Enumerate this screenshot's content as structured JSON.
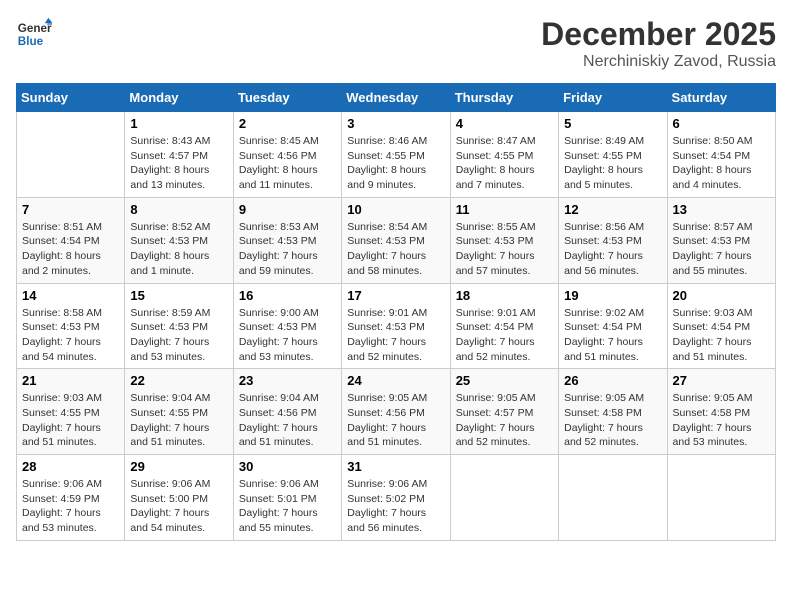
{
  "logo": {
    "line1": "General",
    "line2": "Blue"
  },
  "title": "December 2025",
  "subtitle": "Nerchiniskiy Zavod, Russia",
  "days_of_week": [
    "Sunday",
    "Monday",
    "Tuesday",
    "Wednesday",
    "Thursday",
    "Friday",
    "Saturday"
  ],
  "weeks": [
    [
      {
        "day": "",
        "info": ""
      },
      {
        "day": "1",
        "info": "Sunrise: 8:43 AM\nSunset: 4:57 PM\nDaylight: 8 hours\nand 13 minutes."
      },
      {
        "day": "2",
        "info": "Sunrise: 8:45 AM\nSunset: 4:56 PM\nDaylight: 8 hours\nand 11 minutes."
      },
      {
        "day": "3",
        "info": "Sunrise: 8:46 AM\nSunset: 4:55 PM\nDaylight: 8 hours\nand 9 minutes."
      },
      {
        "day": "4",
        "info": "Sunrise: 8:47 AM\nSunset: 4:55 PM\nDaylight: 8 hours\nand 7 minutes."
      },
      {
        "day": "5",
        "info": "Sunrise: 8:49 AM\nSunset: 4:55 PM\nDaylight: 8 hours\nand 5 minutes."
      },
      {
        "day": "6",
        "info": "Sunrise: 8:50 AM\nSunset: 4:54 PM\nDaylight: 8 hours\nand 4 minutes."
      }
    ],
    [
      {
        "day": "7",
        "info": "Sunrise: 8:51 AM\nSunset: 4:54 PM\nDaylight: 8 hours\nand 2 minutes."
      },
      {
        "day": "8",
        "info": "Sunrise: 8:52 AM\nSunset: 4:53 PM\nDaylight: 8 hours\nand 1 minute."
      },
      {
        "day": "9",
        "info": "Sunrise: 8:53 AM\nSunset: 4:53 PM\nDaylight: 7 hours\nand 59 minutes."
      },
      {
        "day": "10",
        "info": "Sunrise: 8:54 AM\nSunset: 4:53 PM\nDaylight: 7 hours\nand 58 minutes."
      },
      {
        "day": "11",
        "info": "Sunrise: 8:55 AM\nSunset: 4:53 PM\nDaylight: 7 hours\nand 57 minutes."
      },
      {
        "day": "12",
        "info": "Sunrise: 8:56 AM\nSunset: 4:53 PM\nDaylight: 7 hours\nand 56 minutes."
      },
      {
        "day": "13",
        "info": "Sunrise: 8:57 AM\nSunset: 4:53 PM\nDaylight: 7 hours\nand 55 minutes."
      }
    ],
    [
      {
        "day": "14",
        "info": "Sunrise: 8:58 AM\nSunset: 4:53 PM\nDaylight: 7 hours\nand 54 minutes."
      },
      {
        "day": "15",
        "info": "Sunrise: 8:59 AM\nSunset: 4:53 PM\nDaylight: 7 hours\nand 53 minutes."
      },
      {
        "day": "16",
        "info": "Sunrise: 9:00 AM\nSunset: 4:53 PM\nDaylight: 7 hours\nand 53 minutes."
      },
      {
        "day": "17",
        "info": "Sunrise: 9:01 AM\nSunset: 4:53 PM\nDaylight: 7 hours\nand 52 minutes."
      },
      {
        "day": "18",
        "info": "Sunrise: 9:01 AM\nSunset: 4:54 PM\nDaylight: 7 hours\nand 52 minutes."
      },
      {
        "day": "19",
        "info": "Sunrise: 9:02 AM\nSunset: 4:54 PM\nDaylight: 7 hours\nand 51 minutes."
      },
      {
        "day": "20",
        "info": "Sunrise: 9:03 AM\nSunset: 4:54 PM\nDaylight: 7 hours\nand 51 minutes."
      }
    ],
    [
      {
        "day": "21",
        "info": "Sunrise: 9:03 AM\nSunset: 4:55 PM\nDaylight: 7 hours\nand 51 minutes."
      },
      {
        "day": "22",
        "info": "Sunrise: 9:04 AM\nSunset: 4:55 PM\nDaylight: 7 hours\nand 51 minutes."
      },
      {
        "day": "23",
        "info": "Sunrise: 9:04 AM\nSunset: 4:56 PM\nDaylight: 7 hours\nand 51 minutes."
      },
      {
        "day": "24",
        "info": "Sunrise: 9:05 AM\nSunset: 4:56 PM\nDaylight: 7 hours\nand 51 minutes."
      },
      {
        "day": "25",
        "info": "Sunrise: 9:05 AM\nSunset: 4:57 PM\nDaylight: 7 hours\nand 52 minutes."
      },
      {
        "day": "26",
        "info": "Sunrise: 9:05 AM\nSunset: 4:58 PM\nDaylight: 7 hours\nand 52 minutes."
      },
      {
        "day": "27",
        "info": "Sunrise: 9:05 AM\nSunset: 4:58 PM\nDaylight: 7 hours\nand 53 minutes."
      }
    ],
    [
      {
        "day": "28",
        "info": "Sunrise: 9:06 AM\nSunset: 4:59 PM\nDaylight: 7 hours\nand 53 minutes."
      },
      {
        "day": "29",
        "info": "Sunrise: 9:06 AM\nSunset: 5:00 PM\nDaylight: 7 hours\nand 54 minutes."
      },
      {
        "day": "30",
        "info": "Sunrise: 9:06 AM\nSunset: 5:01 PM\nDaylight: 7 hours\nand 55 minutes."
      },
      {
        "day": "31",
        "info": "Sunrise: 9:06 AM\nSunset: 5:02 PM\nDaylight: 7 hours\nand 56 minutes."
      },
      {
        "day": "",
        "info": ""
      },
      {
        "day": "",
        "info": ""
      },
      {
        "day": "",
        "info": ""
      }
    ]
  ]
}
